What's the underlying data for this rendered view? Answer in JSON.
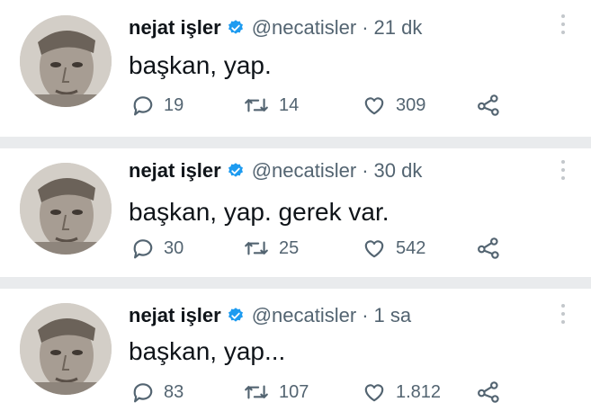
{
  "colors": {
    "verified": "#1d9bf0",
    "text_primary": "#0f1419",
    "text_secondary": "#536471",
    "separator": "#e9ebed"
  },
  "tweets": [
    {
      "name": "nejat işler",
      "handle": "@necatisler",
      "separator": "·",
      "time": "21 dk",
      "text": "başkan, yap.",
      "replies": "19",
      "retweets": "14",
      "likes": "309"
    },
    {
      "name": "nejat işler",
      "handle": "@necatisler",
      "separator": "·",
      "time": "30 dk",
      "text": "başkan, yap. gerek var.",
      "replies": "30",
      "retweets": "25",
      "likes": "542"
    },
    {
      "name": "nejat işler",
      "handle": "@necatisler",
      "separator": "·",
      "time": "1 sa",
      "text": "başkan, yap...",
      "replies": "83",
      "retweets": "107",
      "likes": "1.812"
    }
  ],
  "icons": {
    "verified": "verified-badge-icon",
    "more": "more-vertical-icon",
    "reply": "reply-icon",
    "retweet": "retweet-icon",
    "like": "heart-icon",
    "share": "share-icon"
  }
}
